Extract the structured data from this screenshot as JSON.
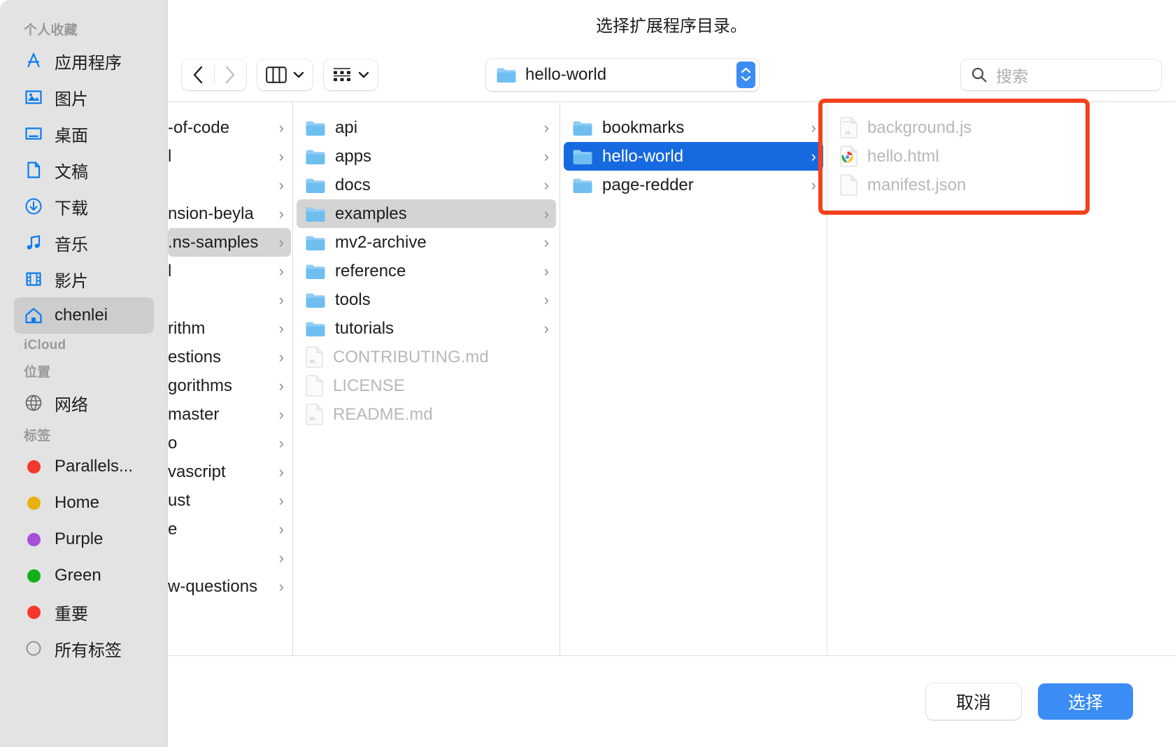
{
  "dialog": {
    "title": "选择扩展程序目录。"
  },
  "toolbar": {
    "back_icon": "chevron-left-icon",
    "forward_icon": "chevron-right-icon",
    "view_icon": "column-view-icon",
    "group_icon": "group-by-icon",
    "path_label": "hello-world",
    "path_folder_icon": "folder-icon",
    "stepper_icon": "stepper-updown-icon",
    "search_icon": "search-icon",
    "search_placeholder": "搜索",
    "search_value": ""
  },
  "sidebar": {
    "sections": [
      {
        "title": "个人收藏"
      },
      {
        "title": "iCloud"
      },
      {
        "title": "位置"
      },
      {
        "title": "标签"
      }
    ],
    "favorites": [
      {
        "label": "应用程序",
        "icon": "applications-icon"
      },
      {
        "label": "图片",
        "icon": "pictures-icon"
      },
      {
        "label": "桌面",
        "icon": "desktop-icon"
      },
      {
        "label": "文稿",
        "icon": "documents-icon"
      },
      {
        "label": "下载",
        "icon": "downloads-icon"
      },
      {
        "label": "音乐",
        "icon": "music-icon"
      },
      {
        "label": "影片",
        "icon": "movies-icon"
      },
      {
        "label": "chenlei",
        "icon": "home-icon",
        "selected": true
      }
    ],
    "locations": [
      {
        "label": "网络",
        "icon": "network-globe-icon"
      }
    ],
    "tags": [
      {
        "label": "Parallels...",
        "color": "#f5382c"
      },
      {
        "label": "Home",
        "color": "#e8b010"
      },
      {
        "label": "Purple",
        "color": "#a750d8"
      },
      {
        "label": "Green",
        "color": "#12b018"
      },
      {
        "label": "重要",
        "color": "#f5382c"
      },
      {
        "label": "所有标签",
        "color": ""
      }
    ]
  },
  "columns": [
    {
      "name": "column-1",
      "scrolled": true,
      "items": [
        {
          "label": "-of-code",
          "type": "folder",
          "chevron": true
        },
        {
          "label": "l",
          "type": "folder",
          "chevron": true
        },
        {
          "label": "",
          "type": "folder",
          "chevron": true
        },
        {
          "label": "nsion-beyla",
          "type": "folder",
          "chevron": true
        },
        {
          "label": ".ns-samples",
          "type": "folder",
          "chevron": true,
          "selected": "gray"
        },
        {
          "label": "l",
          "type": "folder",
          "chevron": true
        },
        {
          "label": "",
          "type": "folder",
          "chevron": true
        },
        {
          "label": "rithm",
          "type": "folder",
          "chevron": true
        },
        {
          "label": "estions",
          "type": "folder",
          "chevron": true
        },
        {
          "label": "gorithms",
          "type": "folder",
          "chevron": true
        },
        {
          "label": "master",
          "type": "folder",
          "chevron": true
        },
        {
          "label": "o",
          "type": "folder",
          "chevron": true
        },
        {
          "label": "vascript",
          "type": "folder",
          "chevron": true
        },
        {
          "label": "ust",
          "type": "folder",
          "chevron": true
        },
        {
          "label": "e",
          "type": "folder",
          "chevron": true
        },
        {
          "label": "",
          "type": "folder",
          "chevron": true
        },
        {
          "label": "w-questions",
          "type": "folder",
          "chevron": true
        }
      ]
    },
    {
      "name": "column-2",
      "items": [
        {
          "label": "api",
          "type": "folder",
          "chevron": true
        },
        {
          "label": "apps",
          "type": "folder",
          "chevron": true
        },
        {
          "label": "docs",
          "type": "folder",
          "chevron": true
        },
        {
          "label": "examples",
          "type": "folder",
          "chevron": true,
          "selected": "gray"
        },
        {
          "label": "mv2-archive",
          "type": "folder",
          "chevron": true
        },
        {
          "label": "reference",
          "type": "folder",
          "chevron": true
        },
        {
          "label": "tools",
          "type": "folder",
          "chevron": true
        },
        {
          "label": "tutorials",
          "type": "folder",
          "chevron": true
        },
        {
          "label": "CONTRIBUTING.md",
          "type": "markdown",
          "chevron": false,
          "disabled": true
        },
        {
          "label": "LICENSE",
          "type": "file",
          "chevron": false,
          "disabled": true
        },
        {
          "label": "README.md",
          "type": "markdown",
          "chevron": false,
          "disabled": true
        }
      ]
    },
    {
      "name": "column-3",
      "items": [
        {
          "label": "bookmarks",
          "type": "folder",
          "chevron": true
        },
        {
          "label": "hello-world",
          "type": "folder",
          "chevron": true,
          "selected": "blue"
        },
        {
          "label": "page-redder",
          "type": "folder",
          "chevron": true
        }
      ]
    },
    {
      "name": "column-4",
      "items": [
        {
          "label": "background.js",
          "type": "js",
          "chevron": false,
          "disabled": true
        },
        {
          "label": "hello.html",
          "type": "chrome",
          "chevron": false,
          "disabled": true
        },
        {
          "label": "manifest.json",
          "type": "file",
          "chevron": false,
          "disabled": true
        }
      ]
    }
  ],
  "footer": {
    "cancel_label": "取消",
    "choose_label": "选择"
  },
  "annotation": {
    "color": "#f2411c"
  }
}
